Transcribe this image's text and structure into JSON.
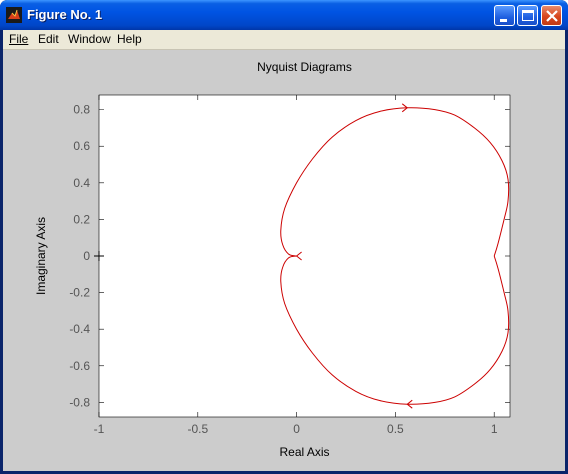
{
  "window": {
    "title": "Figure No. 1",
    "controls": [
      "minimize",
      "maximize",
      "close"
    ]
  },
  "menu": {
    "items": [
      "File",
      "Edit",
      "Window",
      "Help"
    ]
  },
  "plot": {
    "title": "Nyquist Diagrams",
    "xlabel": "Real Axis",
    "ylabel": "Imaginary Axis",
    "curve_color": "#cc0000",
    "background": "#ffffff",
    "figure_bg": "#cccccc"
  },
  "chart_data": {
    "type": "line",
    "title": "Nyquist Diagrams",
    "xlabel": "Real Axis",
    "ylabel": "Imaginary Axis",
    "xlim": [
      -1,
      1.08
    ],
    "ylim": [
      -0.88,
      0.88
    ],
    "xticks": [
      -1,
      -0.5,
      0,
      0.5,
      1
    ],
    "xtick_labels": [
      "-1",
      "-0.5",
      "0",
      "0.5",
      "1"
    ],
    "yticks": [
      -0.8,
      -0.6,
      -0.4,
      -0.2,
      0,
      0.2,
      0.4,
      0.6,
      0.8
    ],
    "ytick_labels": [
      "-0.8",
      "-0.6",
      "-0.4",
      "-0.2",
      "0",
      "0.2",
      "0.4",
      "0.6",
      "0.8"
    ],
    "critical_point": [
      -1,
      0
    ],
    "series": [
      {
        "x": [
          1.0,
          1.02,
          1.05,
          1.07,
          1.07,
          1.04,
          0.98,
          0.9,
          0.8,
          0.7,
          0.56,
          0.42,
          0.3,
          0.18,
          0.08,
          0.0,
          -0.06,
          -0.08,
          -0.07,
          -0.04,
          0.0
        ],
        "y": [
          0.0,
          0.07,
          0.2,
          0.3,
          0.42,
          0.52,
          0.62,
          0.7,
          0.77,
          0.8,
          0.81,
          0.79,
          0.74,
          0.65,
          0.53,
          0.4,
          0.26,
          0.14,
          0.06,
          0.01,
          0.0
        ]
      },
      {
        "x": [
          0.0,
          -0.04,
          -0.07,
          -0.08,
          -0.06,
          0.0,
          0.08,
          0.18,
          0.3,
          0.42,
          0.56,
          0.7,
          0.8,
          0.9,
          0.98,
          1.04,
          1.07,
          1.07,
          1.05,
          1.02,
          1.0
        ],
        "y": [
          0.0,
          -0.01,
          -0.06,
          -0.14,
          -0.26,
          -0.4,
          -0.53,
          -0.65,
          -0.74,
          -0.79,
          -0.81,
          -0.8,
          -0.77,
          -0.7,
          -0.62,
          -0.52,
          -0.42,
          -0.3,
          -0.2,
          -0.07,
          0.0
        ]
      }
    ],
    "arrows": [
      {
        "x": 0.56,
        "y": 0.81,
        "direction": "right"
      },
      {
        "x": 0.56,
        "y": -0.81,
        "direction": "left"
      },
      {
        "x": 0.0,
        "y": 0.0,
        "direction": "left"
      }
    ],
    "grid": false
  }
}
